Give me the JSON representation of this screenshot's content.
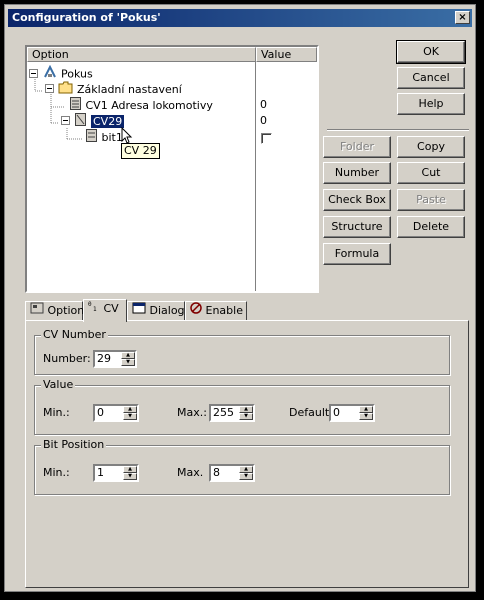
{
  "window": {
    "title": "Configuration of 'Pokus'",
    "close_label": "×"
  },
  "tree": {
    "headers": {
      "option": "Option",
      "value": "Value"
    },
    "rows": [
      {
        "label": "Pokus",
        "value": ""
      },
      {
        "label": "Základní nastavení",
        "value": ""
      },
      {
        "label": "CV1 Adresa lokomotivy",
        "value": "0"
      },
      {
        "label": "CV29",
        "value": "0"
      },
      {
        "label": "bit1",
        "value": ""
      }
    ],
    "tooltip": "CV 29"
  },
  "buttons": {
    "ok": "OK",
    "cancel": "Cancel",
    "help": "Help",
    "folder": "Folder",
    "copy": "Copy",
    "number": "Number",
    "cut": "Cut",
    "checkbox": "Check Box",
    "paste": "Paste",
    "structure": "Structure",
    "delete": "Delete",
    "formula": "Formula"
  },
  "tabs": [
    {
      "label": "Option",
      "icon": "option-icon"
    },
    {
      "label": "CV",
      "icon": "cv-icon"
    },
    {
      "label": "Dialog",
      "icon": "dialog-icon"
    },
    {
      "label": "Enable",
      "icon": "enable-icon"
    }
  ],
  "cv_number": {
    "title": "CV Number",
    "number_label": "Number:",
    "number_value": "29"
  },
  "value_group": {
    "title": "Value",
    "min_label": "Min.:",
    "min_value": "0",
    "max_label": "Max.:",
    "max_value": "255",
    "default_label": "Default:",
    "default_value": "0"
  },
  "bit_position": {
    "title": "Bit Position",
    "min_label": "Min.:",
    "min_value": "1",
    "max_label": "Max.",
    "max_value": "8"
  },
  "colors": {
    "titlebar": "#0a246a",
    "face": "#d4d0c8",
    "selection": "#0a246a",
    "tooltip": "#ffffe1"
  }
}
